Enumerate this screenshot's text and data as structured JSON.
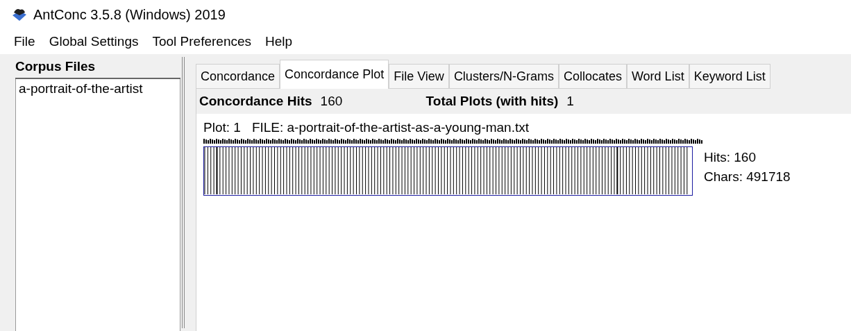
{
  "window": {
    "title": "AntConc 3.5.8 (Windows) 2019"
  },
  "menu": [
    "File",
    "Global Settings",
    "Tool Preferences",
    "Help"
  ],
  "corpus_files": {
    "heading": "Corpus Files",
    "items": [
      {
        "label": "a-portrait-of-the-artist",
        "selected": false
      }
    ]
  },
  "tabs": [
    {
      "label": "Concordance",
      "selected": false
    },
    {
      "label": "Concordance Plot",
      "selected": true
    },
    {
      "label": "File View",
      "selected": false
    },
    {
      "label": "Clusters/N-Grams",
      "selected": false
    },
    {
      "label": "Collocates",
      "selected": false
    },
    {
      "label": "Word List",
      "selected": false
    },
    {
      "label": "Keyword List",
      "selected": false
    }
  ],
  "summary": {
    "hits_label": "Concordance Hits",
    "hits_value": "160",
    "plots_label": "Total Plots (with hits)",
    "plots_value": "1"
  },
  "plot": {
    "plot_label": "Plot: 1",
    "file_label": "FILE: a-portrait-of-the-artist-as-a-young-man.txt",
    "hits": "Hits: 160",
    "chars": "Chars: 491718"
  }
}
